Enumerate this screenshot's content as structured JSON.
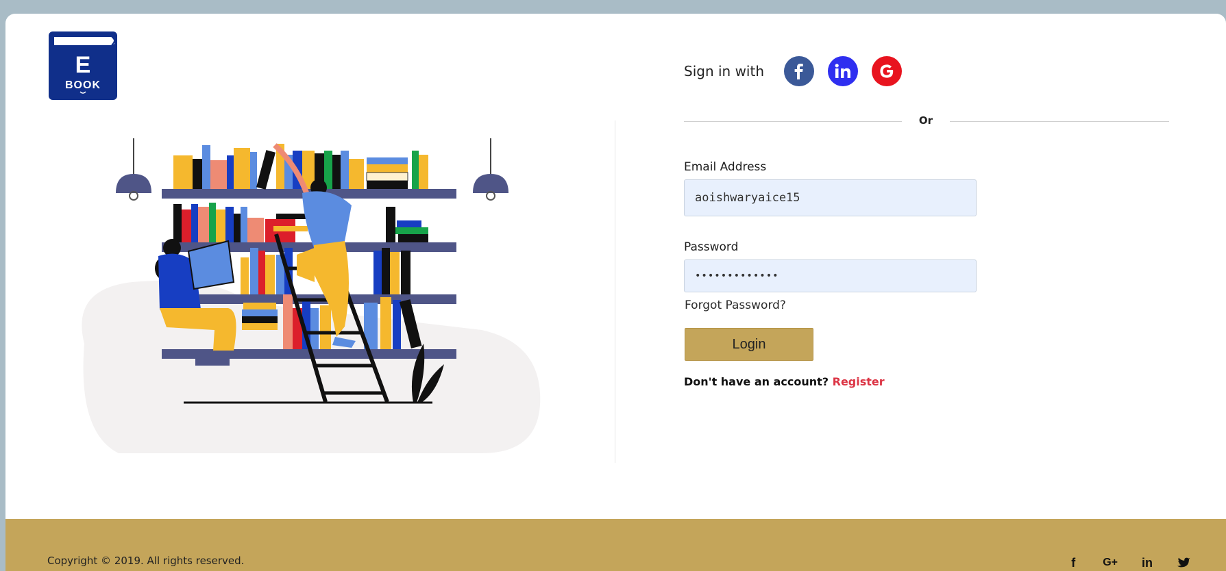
{
  "logo": {
    "letter": "E",
    "word": "BOOK"
  },
  "signin": {
    "label": "Sign in with",
    "providers": [
      {
        "name": "facebook-icon",
        "glyph": "f",
        "color": "#3b5998"
      },
      {
        "name": "linkedin-icon",
        "glyph": "in",
        "color": "#2f2ff0"
      },
      {
        "name": "google-icon",
        "glyph": "G",
        "color": "#e8141f"
      }
    ]
  },
  "divider": {
    "text": "Or"
  },
  "form": {
    "email_label": "Email Address",
    "email_value": "aoishwaryaice15",
    "password_label": "Password",
    "password_value": "•••••••••••••",
    "forgot_label": "Forgot Password?",
    "login_label": "Login",
    "no_account_text": "Don't have an account?",
    "register_label": "Register"
  },
  "footer": {
    "copyright": "Copyright © 2019. All rights reserved.",
    "icons": [
      "facebook-icon",
      "google-plus-icon",
      "linkedin-icon",
      "twitter-icon"
    ],
    "icon_glyphs": {
      "facebook": "f",
      "google_plus": "G+",
      "linkedin": "in"
    }
  },
  "colors": {
    "accent": "#c4a55a",
    "background": "#a9bcc6",
    "register": "#dc3545",
    "logo_blue": "#102f8a"
  }
}
